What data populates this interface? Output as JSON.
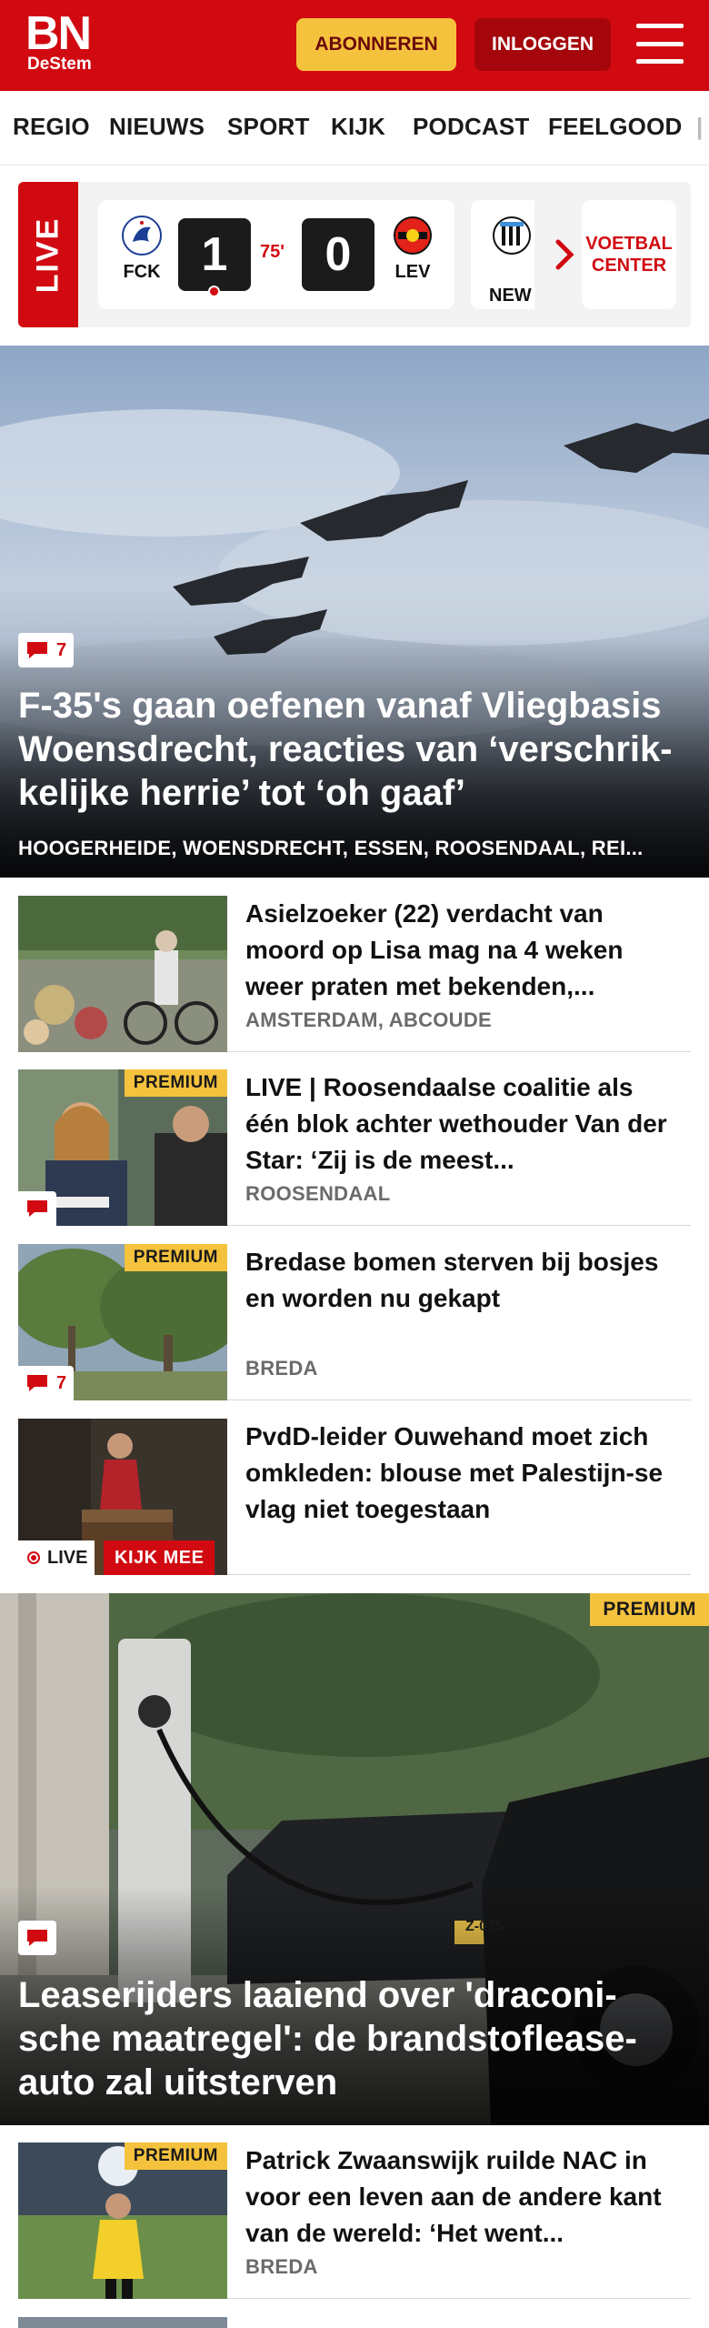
{
  "header": {
    "logo_main": "BN",
    "logo_sub": "DeStem",
    "subscribe_label": "ABONNEREN",
    "login_label": "INLOGGEN"
  },
  "nav": {
    "items": [
      "REGIO",
      "NIEUWS",
      "SPORT",
      "KIJK",
      "PODCAST",
      "FEELGOOD"
    ]
  },
  "live": {
    "tab_label": "LIVE",
    "match": {
      "home": "FCK",
      "away": "LEV",
      "home_score": "1",
      "away_score": "0",
      "minute": "75'"
    },
    "next_match_home": "NEW",
    "voetbal_center_label": "VOETBAL CENTER"
  },
  "hero": {
    "comments": "7",
    "title": "F-35's gaan oefenen vanaf Vliegbasis Woensdrecht, reacties van ‘verschrik-kelijke herrie’ tot ‘oh gaaf’",
    "tags": "HOOGERHEIDE, WOENSDRECHT, ESSEN, ROOSENDAAL, REI..."
  },
  "articles": [
    {
      "title": "Asielzoeker (22) verdacht van moord op Lisa mag na 4 weken weer praten met bekenden,...",
      "tag": "AMSTERDAM, ABCOUDE",
      "premium": "",
      "comments": ""
    },
    {
      "title": "LIVE | Roosendaalse coalitie als één blok achter wethouder Van der Star: ‘Zij is de meest...",
      "tag": "ROOSENDAAL",
      "premium": "PREMIUM",
      "comments": ""
    },
    {
      "title": "Bredase bomen sterven bij bosjes en worden nu gekapt",
      "tag": "BREDA",
      "premium": "PREMIUM",
      "comments": "7"
    },
    {
      "title": "PvdD-leider Ouwehand moet zich omkleden: blouse met Palestijn-se vlag niet toegestaan",
      "tag": "",
      "premium": "",
      "live_label": "LIVE",
      "kijk_mee_label": "KIJK MEE"
    }
  ],
  "big_article": {
    "premium": "PREMIUM",
    "title": "Leaserijders laaiend over 'draconi-sche maatregel': de brandstoflease-auto zal uitsterven",
    "plate": "Z-075"
  },
  "article_bottom": {
    "title": "Patrick Zwaanswijk ruilde NAC in voor een leven aan de andere kant van de wereld: ‘Het went...",
    "tag": "BREDA",
    "premium": "PREMIUM"
  },
  "colors": {
    "brand_red": "#d10a11",
    "premium_yellow": "#f5c23d"
  }
}
